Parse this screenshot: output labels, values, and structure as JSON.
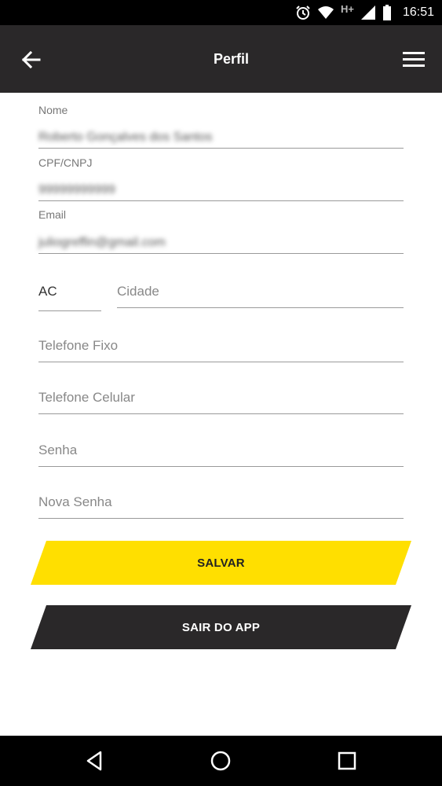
{
  "status_bar": {
    "network_label": "H+",
    "time": "16:51",
    "icons": [
      "alarm-icon",
      "wifi-icon",
      "signal-icon",
      "battery-icon"
    ]
  },
  "app_bar": {
    "title": "Perfil",
    "icons": [
      "arrow-back-icon",
      "hamburger-menu-icon"
    ]
  },
  "form": {
    "name": {
      "label": "Nome",
      "value": "Roberto Gonçalves dos Santos"
    },
    "cpf": {
      "label": "CPF/CNPJ",
      "value": "99999999999"
    },
    "email": {
      "label": "Email",
      "value": "juliogreffin@gmail.com"
    },
    "state": {
      "value": "AC"
    },
    "city": {
      "placeholder": "Cidade"
    },
    "phone": {
      "placeholder": "Telefone Fixo"
    },
    "mobile": {
      "placeholder": "Telefone Celular"
    },
    "password": {
      "placeholder": "Senha"
    },
    "new_password": {
      "placeholder": "Nova Senha"
    }
  },
  "buttons": {
    "save": "SALVAR",
    "exit": "SAIR DO APP"
  },
  "colors": {
    "app_bar": "#2a2829",
    "accent_yellow": "#ffdf00",
    "system_bar": "#000000"
  },
  "nav_bar": {
    "icons": [
      "nav-back-icon",
      "nav-home-icon",
      "nav-recents-icon"
    ]
  }
}
